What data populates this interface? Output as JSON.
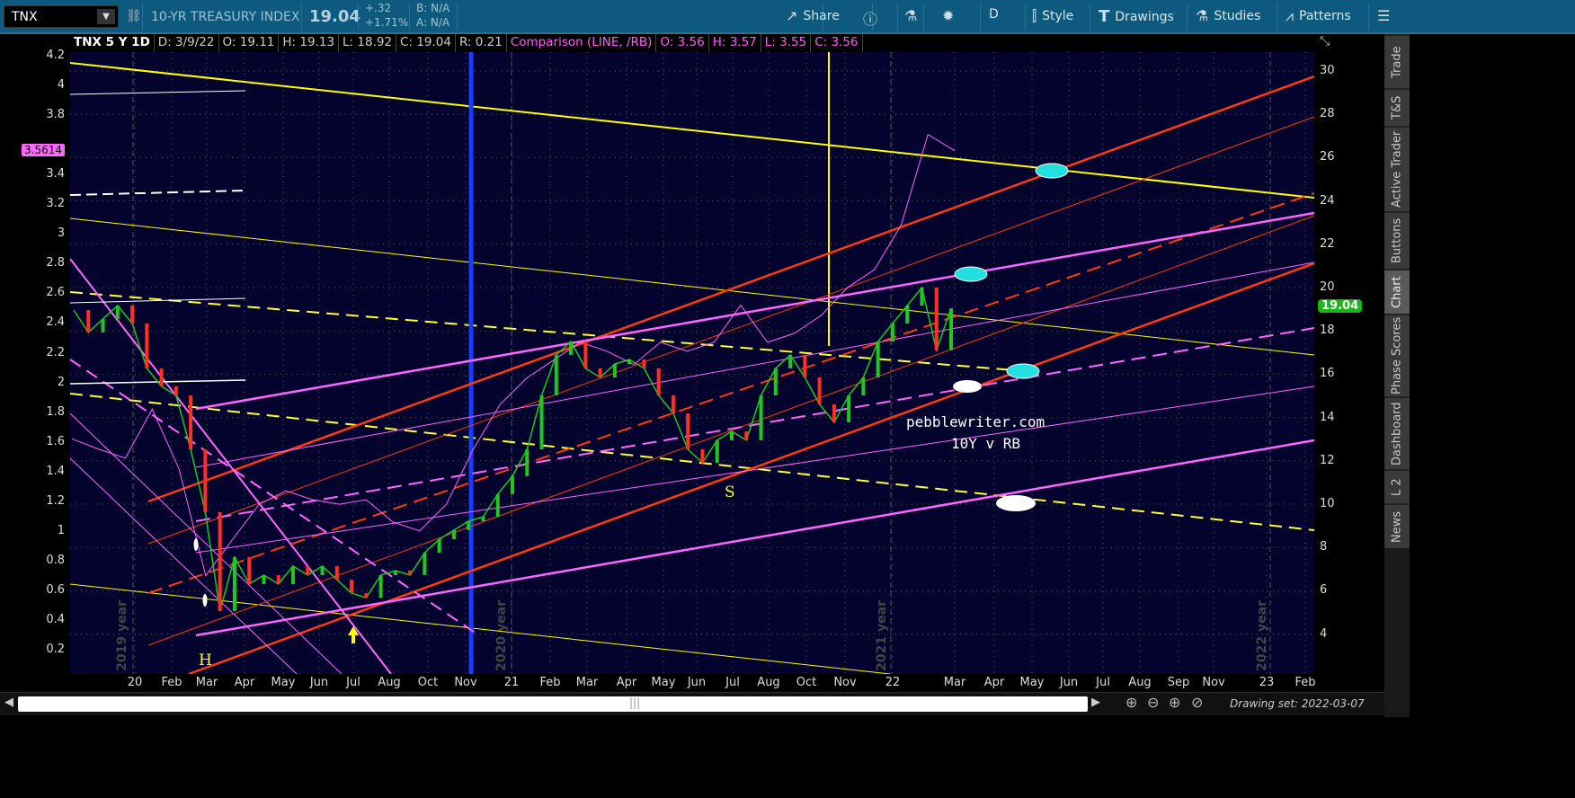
{
  "toolbar": {
    "symbol": "TNX",
    "description": "10-YR TREASURY INDEX",
    "last": "19.04",
    "change": "+.32",
    "change_pct": "+1.71%",
    "bid": "B: N/A",
    "ask": "A: N/A",
    "buttons": {
      "share": "Share",
      "period": "D",
      "style": "Style",
      "drawings": "Drawings",
      "studies": "Studies",
      "patterns": "Patterns"
    }
  },
  "info_bar": {
    "title": "TNX 5 Y 1D",
    "date": "D: 3/9/22",
    "open": "O: 19.11",
    "high": "H: 19.13",
    "low": "L: 18.92",
    "close": "C: 19.04",
    "range": "R: 0.21",
    "comparison_label": "Comparison (LINE, /RB)",
    "cmp_open": "O: 3.56",
    "cmp_high": "H: 3.57",
    "cmp_low": "L: 3.55",
    "cmp_close": "C: 3.56"
  },
  "left_axis": {
    "ticks": [
      "4.2",
      "4",
      "3.8",
      "3.4",
      "3.2",
      "3",
      "2.8",
      "2.6",
      "2.4",
      "2.2",
      "2",
      "1.8",
      "1.6",
      "1.4",
      "1.2",
      "1",
      "0.8",
      "0.6",
      "0.4",
      "0.2"
    ],
    "current": "3.5614"
  },
  "right_axis": {
    "ticks": [
      "30",
      "28",
      "26",
      "24",
      "22",
      "20",
      "18",
      "16",
      "14",
      "12",
      "10",
      "8",
      "6",
      "4"
    ],
    "current": "19.04"
  },
  "x_axis": {
    "labels": [
      "20",
      "Feb",
      "Mar",
      "Apr",
      "May",
      "Jun",
      "Jul",
      "Aug",
      "Oct",
      "Nov",
      "21",
      "Feb",
      "Mar",
      "Apr",
      "May",
      "Jun",
      "Jul",
      "Aug",
      "Oct",
      "Nov",
      "22",
      "Mar",
      "Apr",
      "May",
      "Jun",
      "Jul",
      "Aug",
      "Sep",
      "Nov",
      "23",
      "Feb"
    ]
  },
  "year_markers": [
    "2019 year",
    "2020 year",
    "2021 year",
    "2022 year"
  ],
  "annotations": {
    "site": "pebblewriter.com",
    "subtitle": "10Y v RB",
    "s_label": "S",
    "h_label": "H"
  },
  "side_tabs": [
    "Trade",
    "T&S",
    "Active Trader",
    "Buttons",
    "Chart",
    "Phase Scores",
    "Dashboard",
    "L 2",
    "News"
  ],
  "active_tab": "Chart",
  "status": {
    "drawing_set": "Drawing set: 2022-03-07"
  },
  "colors": {
    "background": "#03032e",
    "tnx_up": "#1ec81e",
    "tnx_down": "#ff3020",
    "comparison": "#ff66ff",
    "toolbar": "#0e5a7e"
  },
  "chart_data": {
    "type": "line",
    "series": [
      {
        "name": "TNX",
        "axis": "right",
        "values": [
          18.96,
          17.93,
          18.55,
          19.17,
          18.34,
          16.27,
          15.44,
          15.02,
          12.53,
          9.63,
          5.06,
          7.55,
          6.31,
          6.72,
          6.31,
          7.14,
          6.72,
          7.14,
          6.51,
          5.89,
          5.68,
          6.72,
          6.93,
          6.72,
          7.76,
          8.38,
          8.8,
          9.21,
          9.42,
          10.46,
          11.29,
          12.53,
          15.02,
          16.89,
          17.51,
          16.27,
          15.85,
          16.47,
          16.68,
          16.27,
          15.02,
          14.19,
          12.53,
          11.91,
          12.95,
          13.36,
          12.95,
          15.02,
          16.27,
          16.89,
          15.85,
          14.61,
          13.78,
          15.02,
          15.85,
          17.51,
          18.34,
          19.17,
          20.0,
          17.1,
          19.04
        ]
      },
      {
        "name": "/RB",
        "axis": "left",
        "values": [
          1.62,
          1.55,
          1.49,
          1.82,
          1.42,
          0.7,
          0.94,
          1.18,
          1.27,
          1.21,
          1.18,
          1.21,
          1.06,
          1.0,
          1.18,
          1.55,
          1.85,
          2.03,
          2.15,
          2.27,
          2.21,
          2.12,
          2.27,
          2.21,
          2.27,
          2.52,
          2.27,
          2.33,
          2.45,
          2.64,
          2.76,
          3.06,
          3.67,
          3.56
        ]
      }
    ],
    "left_ylim": [
      0.1,
      4.25
    ],
    "right_ylim": [
      2.5,
      31
    ],
    "xlabel": "",
    "ylabel": ""
  }
}
